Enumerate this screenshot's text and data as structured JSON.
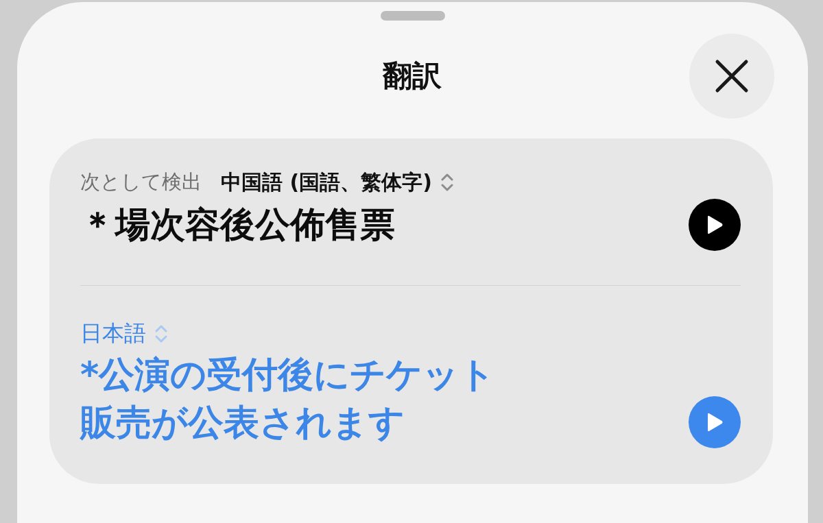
{
  "title": "翻訳",
  "panels": [
    {
      "kind": "source",
      "caption": "次として検出",
      "language": "中国語 (国語、繁体字)",
      "lines": [
        "＊場次容後公佈售票"
      ]
    },
    {
      "kind": "target",
      "language": "日本語",
      "lines": [
        "*公演の受付後にチケット",
        "販売が公表されます"
      ]
    }
  ]
}
